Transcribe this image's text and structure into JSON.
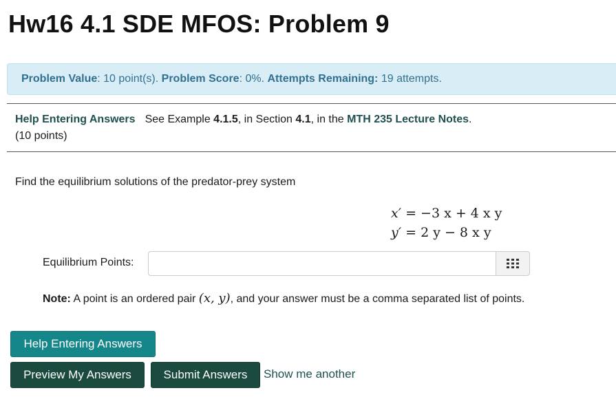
{
  "page": {
    "title": "Hw16 4.1 SDE MFOS: Problem 9"
  },
  "info": {
    "value_label": "Problem Value",
    "value_text": ": 10 point(s). ",
    "score_label": "Problem Score",
    "score_text": ": 0%. ",
    "attempts_label": "Attempts Remaining:",
    "attempts_text": " 19 attempts."
  },
  "header": {
    "help_link": "Help Entering Answers",
    "see_prefix": "See Example ",
    "example_num": "4.1.5",
    "section_prefix": ", in Section ",
    "section_num": "4.1",
    "in_the": ", in the ",
    "notes_title": "MTH 235 Lecture Notes",
    "period": ".",
    "points": "(10 points)"
  },
  "problem": {
    "statement": "Find the equilibrium solutions of the predator-prey system",
    "eq1_lhs": "x′",
    "eq1_rhs": "= −3 x + 4 x y",
    "eq2_lhs": "y′",
    "eq2_rhs": "= 2 y − 8 x y"
  },
  "answer": {
    "label": "Equilibrium Points:",
    "value": "",
    "placeholder": "",
    "palette_icon": "grid-keypad-icon"
  },
  "note": {
    "label": "Note:",
    "text_before": " A point is an ordered pair ",
    "pair": "(x, y)",
    "text_after": ", and your answer must be a comma separated list of points."
  },
  "buttons": {
    "help": "Help Entering Answers",
    "preview": "Preview My Answers",
    "submit": "Submit Answers",
    "show_another": "Show me another"
  },
  "colors": {
    "info_bg": "#d9edf7",
    "info_text": "#31708f",
    "help_button": "#15878a",
    "action_button": "#1b4a3f"
  }
}
